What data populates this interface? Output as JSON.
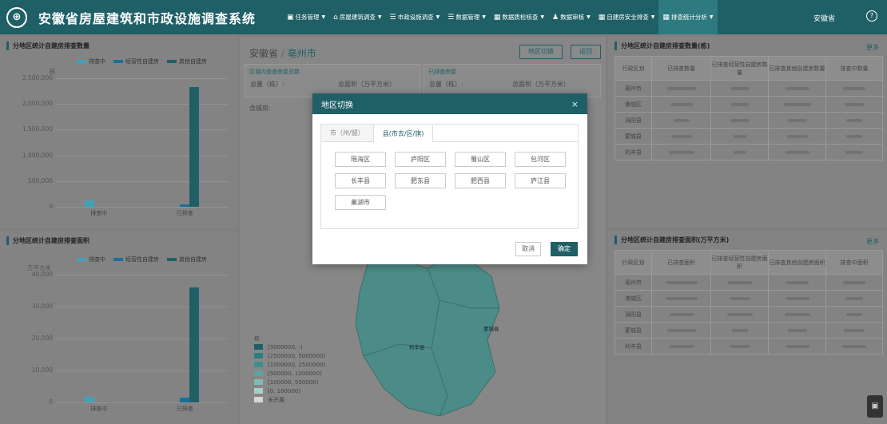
{
  "app": {
    "logo_glyph": "⊕",
    "title": "安徽省房屋建筑和市政设施调查系统",
    "user": "安徽省",
    "help": "?"
  },
  "nav": [
    {
      "icon": "doc-icon",
      "glyph": "▣",
      "label": "任务管理"
    },
    {
      "icon": "house-icon",
      "glyph": "⌂",
      "label": "房屋建筑调查"
    },
    {
      "icon": "list-icon",
      "glyph": "☰",
      "label": "市政设施调查"
    },
    {
      "icon": "list-icon",
      "glyph": "☰",
      "label": "数据管理"
    },
    {
      "icon": "table-icon",
      "glyph": "▦",
      "label": "数据质检核查"
    },
    {
      "icon": "user-icon",
      "glyph": "♟",
      "label": "数据审核"
    },
    {
      "icon": "table-icon",
      "glyph": "▦",
      "label": "自建房安全排查"
    },
    {
      "icon": "table-icon",
      "glyph": "▦",
      "label": "排查统计分析",
      "active": true
    }
  ],
  "colors": {
    "accent": "#1f5f66",
    "bar_series1": "#3fa3b8",
    "bar_series2": "#1a6f97",
    "bar_series3": "#1f5f66"
  },
  "left_top": {
    "title": "分地区统计自建房排查数量",
    "unit": "栋",
    "legend": [
      "排查中",
      "经营性自建房",
      "其他自建房"
    ]
  },
  "left_bottom": {
    "title": "分地区统计自建房排查面积",
    "unit": "万平方米",
    "legend": [
      "排查中",
      "经营性自建房",
      "其他自建房"
    ]
  },
  "chart_data": [
    {
      "type": "bar",
      "title": "分地区统计自建房排查数量",
      "ylabel": "栋",
      "categories": [
        "排查中",
        "已排查"
      ],
      "ylim": [
        0,
        2500000
      ],
      "yticks": [
        "2,500,000",
        "2,000,000",
        "1,500,000",
        "1,000,000",
        "500,000",
        "0"
      ],
      "series": [
        {
          "name": "排查中",
          "values": [
            120000,
            0
          ]
        },
        {
          "name": "经营性自建房",
          "values": [
            0,
            50000
          ]
        },
        {
          "name": "其他自建房",
          "values": [
            0,
            2330000
          ]
        }
      ]
    },
    {
      "type": "bar",
      "title": "分地区统计自建房排查面积",
      "ylabel": "万平方米",
      "categories": [
        "排查中",
        "已排查"
      ],
      "ylim": [
        0,
        40000
      ],
      "yticks": [
        "40,000",
        "30,000",
        "20,000",
        "10,000",
        "0"
      ],
      "series": [
        {
          "name": "排查中",
          "values": [
            1700,
            0
          ]
        },
        {
          "name": "经营性自建房",
          "values": [
            0,
            1600
          ]
        },
        {
          "name": "其他自建房",
          "values": [
            0,
            36000
          ]
        }
      ]
    }
  ],
  "center": {
    "province": "安徽省",
    "separator": "/",
    "city": "亳州市",
    "switch_button": "地区切换",
    "back_button": "返回",
    "card1_title": "区域内查查房屋总数",
    "card2_title": "已排查房屋",
    "total_label": "总量（栋）:",
    "area_label": "总面积（万平方米）",
    "shop_label": "含城房:",
    "map_legend_title": "栋",
    "map_legend": [
      "[5000000, -)",
      "[2500000, 5000000)",
      "[1000000, 2500000)",
      "[500000, 1000000)",
      "[100000, 500000)",
      "[0, 100000)",
      "未开展"
    ],
    "map_legend_colors": [
      "#1f5f66",
      "#2e7c84",
      "#3f8e8e",
      "#5ba3a0",
      "#7dbab8",
      "#a6cfcf",
      "#d6d6d6"
    ],
    "map_region_labels": [
      "利辛县",
      "蒙城县"
    ]
  },
  "right_top": {
    "title": "分地区统计自建房排查数量(栋)",
    "more": "更多",
    "columns": [
      "行政区划",
      "已排查数量",
      "已排查经营性自建房数量",
      "已排查其他自建房数量",
      "排查中数量"
    ],
    "rows": [
      "亳州市",
      "谯城区",
      "涡阳县",
      "蒙城县",
      "利辛县"
    ]
  },
  "right_bottom": {
    "title": "分地区统计自建房排查面积(万平方米)",
    "more": "更多",
    "columns": [
      "行政区划",
      "已排查面积",
      "已排查经营性自建房面积",
      "已排查其他自建房面积",
      "排查中面积"
    ],
    "rows": [
      "亳州市",
      "谯城区",
      "涡阳县",
      "蒙城县",
      "利辛县"
    ]
  },
  "modal": {
    "title": "地区切换",
    "close": "×",
    "tab_city": "市（州/盟）",
    "tab_county": "县(市去/区/旗)",
    "counties": [
      "瑶海区",
      "庐阳区",
      "蜀山区",
      "包河区",
      "长丰县",
      "肥东县",
      "肥西县",
      "庐江县",
      "巢湖市"
    ],
    "cancel": "取消",
    "confirm": "确定"
  },
  "corner_glyph": "▣"
}
